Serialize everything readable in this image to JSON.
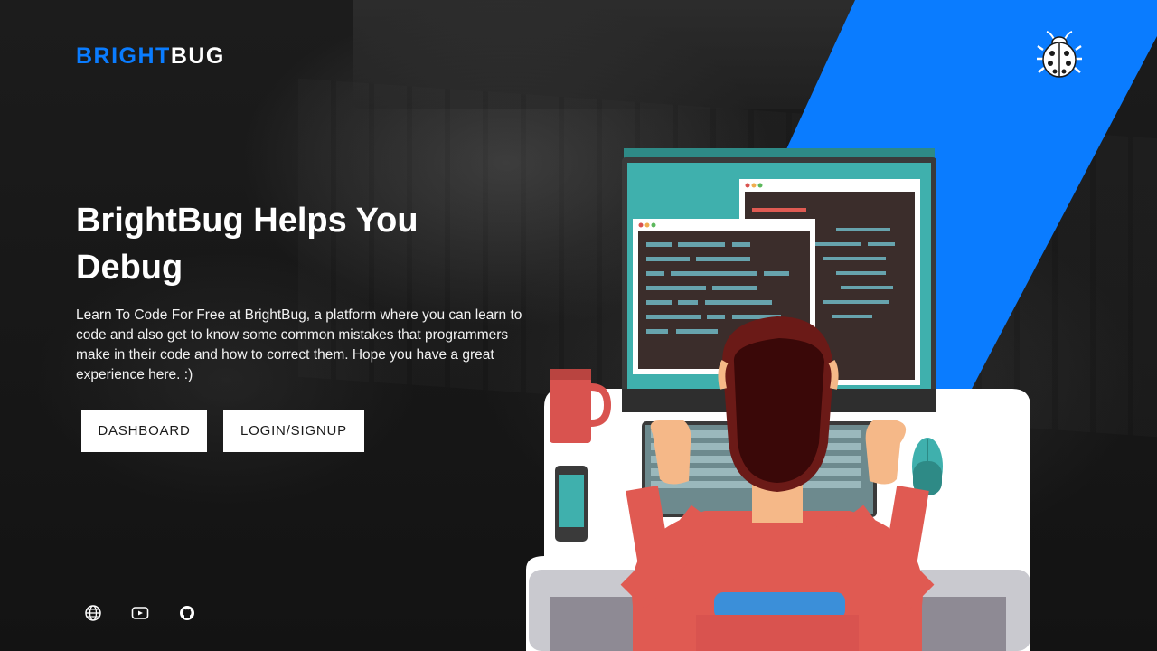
{
  "brand": {
    "name_part1": "BRIGHT",
    "name_part2": "BUG",
    "accent_color": "#0a7cff"
  },
  "header": {
    "bug_icon": "ladybug-icon"
  },
  "hero": {
    "title": "BrightBug Helps You Debug",
    "description": "Learn To Code For Free at BrightBug, a platform where you can learn to code and also get to know some common mistakes that programmers make in their code and how to correct them. Hope you have a great experience here. :)"
  },
  "buttons": {
    "dashboard": "DASHBOARD",
    "login": "LOGIN/SIGNUP"
  },
  "social": {
    "icons": [
      "globe-icon",
      "youtube-icon",
      "github-icon"
    ]
  }
}
